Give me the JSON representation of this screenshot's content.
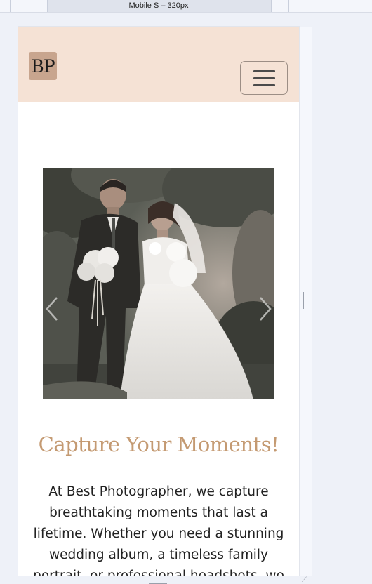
{
  "devtools": {
    "device_label": "Mobile S – 320px"
  },
  "site": {
    "logo_text": "BP",
    "menu_icon": "hamburger-icon",
    "brand_colors": {
      "header_bg": "#f5e2d5",
      "logo_bg": "#c8a58e",
      "headline": "#c49a72"
    }
  },
  "carousel": {
    "prev_icon": "chevron-left-icon",
    "next_icon": "chevron-right-icon"
  },
  "content": {
    "headline": "Capture Your Moments!",
    "body": "At Best Photographer, we capture breathtaking moments that last a lifetime. Whether you need a stunning wedding album, a timeless family portrait, or professional headshots, we"
  }
}
